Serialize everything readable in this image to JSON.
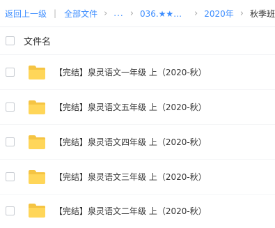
{
  "breadcrumb": {
    "back": "返回上一级",
    "separator": "|",
    "root": "全部文件",
    "ellipsis": "...",
    "level1": "036.★★★泉...",
    "level2": "2020年",
    "current": "秋季班",
    "chevron": "›"
  },
  "header": {
    "column_name": "文件名"
  },
  "files": [
    {
      "name": "【完结】泉灵语文一年级 上（2020-秋）",
      "icon": "folder-icon"
    },
    {
      "name": "【完结】泉灵语文五年级 上（2020-秋）",
      "icon": "folder-icon"
    },
    {
      "name": "【完结】泉灵语文四年级 上（2020-秋）",
      "icon": "folder-icon"
    },
    {
      "name": "【完结】泉灵语文三年级 上（2020-秋）",
      "icon": "folder-icon"
    },
    {
      "name": "【完结】泉灵语文二年级 上（2020-秋）",
      "icon": "folder-icon"
    }
  ],
  "colors": {
    "link": "#3b8cff",
    "folder": "#ffd659",
    "folder_tab": "#f5c443"
  }
}
